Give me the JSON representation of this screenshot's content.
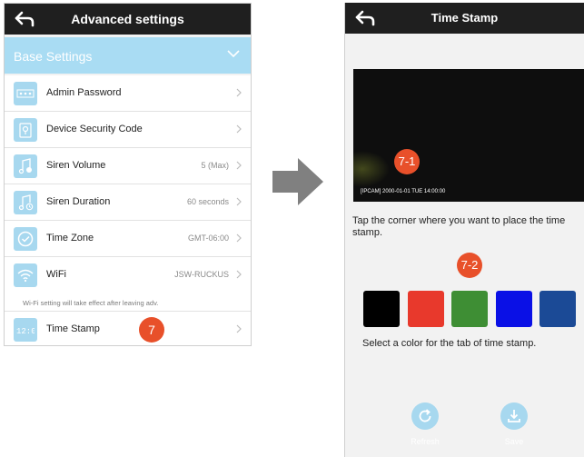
{
  "left": {
    "title": "Advanced settings",
    "section_label": "Base Settings",
    "items": [
      {
        "label": "Admin Password",
        "value": ""
      },
      {
        "label": "Device Security Code",
        "value": ""
      },
      {
        "label": "Siren Volume",
        "value": "5 (Max)"
      },
      {
        "label": "Siren Duration",
        "value": "60 seconds"
      },
      {
        "label": "Time Zone",
        "value": "GMT-06:00"
      },
      {
        "label": "WiFi",
        "value": "JSW-RUCKUS"
      }
    ],
    "wifi_note": "Wi-Fi setting will take effect after leaving adv.",
    "time_stamp_label": "Time Stamp",
    "badge": "7"
  },
  "right": {
    "title": "Time Stamp",
    "camera_timestamp": "[IPCAM] 2000-01-01 TUE 14:00:00",
    "badge_camera": "7-1",
    "instruction_corner": "Tap the corner where you want to place the time stamp.",
    "badge_colors": "7-2",
    "colors": [
      "#000000",
      "#e8392c",
      "#3e8e34",
      "#0a10e6",
      "#1b4a96"
    ],
    "instruction_color": "Select a color for the tab of time stamp.",
    "refresh_label": "Refresh",
    "save_label": "Save"
  },
  "icons": {
    "back": "back-arrow-icon",
    "password": "password-dots-icon",
    "security": "lock-icon",
    "volume": "music-note-icon",
    "duration": "music-note-clock-icon",
    "timezone": "clock-icon",
    "wifi": "wifi-icon",
    "timestamp": "digital-clock-icon",
    "refresh": "refresh-icon",
    "save": "download-icon"
  },
  "colors": {
    "topbar": "#1f1f1f",
    "section": "#a9dcf3",
    "icon_bg": "#a7d8ef",
    "badge": "#e8502a",
    "arrow": "#808080"
  }
}
